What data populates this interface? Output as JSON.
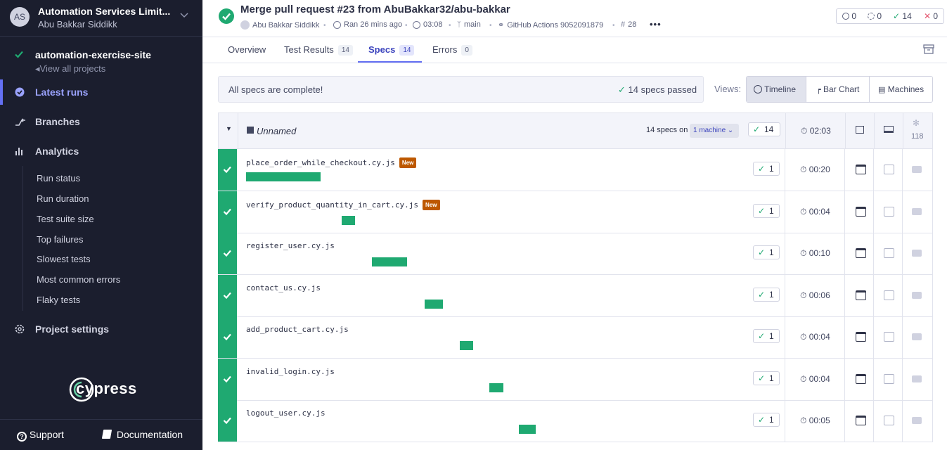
{
  "sidebar": {
    "org_avatar": "AS",
    "org_name": "Automation Services Limit...",
    "org_user": "Abu Bakkar Siddikk",
    "project_name": "automation-exercise-site",
    "view_all": "View all projects",
    "nav": {
      "latest_runs": "Latest runs",
      "branches": "Branches",
      "analytics": "Analytics",
      "project_settings": "Project settings"
    },
    "analytics_items": [
      "Run status",
      "Run duration",
      "Test suite size",
      "Top failures",
      "Slowest tests",
      "Most common errors",
      "Flaky tests"
    ],
    "logo_text": "cypress",
    "support": "Support",
    "documentation": "Documentation"
  },
  "header": {
    "title": "Merge pull request #23 from AbuBakkar32/abu-bakkar",
    "author": "Abu Bakkar Siddikk",
    "ran": "Ran 26 mins ago",
    "duration": "03:08",
    "branch": "main",
    "ci": "GitHub Actions 9052091879",
    "run_number": "28",
    "more": "•••",
    "counts": {
      "skipped": "0",
      "pending": "0",
      "passed": "14",
      "failed": "0"
    }
  },
  "tabs": [
    {
      "label": "Overview",
      "count": ""
    },
    {
      "label": "Test Results",
      "count": "14"
    },
    {
      "label": "Specs",
      "count": "14"
    },
    {
      "label": "Errors",
      "count": "0"
    }
  ],
  "status": {
    "message": "All specs are complete!",
    "passed": "14 specs passed"
  },
  "views": {
    "label": "Views:",
    "timeline": "Timeline",
    "bar_chart": "Bar Chart",
    "machines": "Machines"
  },
  "group": {
    "name": "Unnamed",
    "specs_on": "14 specs on",
    "machine": "1 machine",
    "passed": "14",
    "duration": "02:03",
    "tests": "118"
  },
  "specs": [
    {
      "name": "place_order_while_checkout.cy.js",
      "new": "New",
      "passed": "1",
      "duration": "00:20",
      "start": 0,
      "length": 20
    },
    {
      "name": "verify_product_quantity_in_cart.cy.js",
      "new": "New",
      "passed": "1",
      "duration": "00:04",
      "start": 25.7,
      "length": 3.6
    },
    {
      "name": "register_user.cy.js",
      "new": "",
      "passed": "1",
      "duration": "00:10",
      "start": 33.7,
      "length": 9.6
    },
    {
      "name": "contact_us.cy.js",
      "new": "",
      "passed": "1",
      "duration": "00:06",
      "start": 47.9,
      "length": 4.9
    },
    {
      "name": "add_product_cart.cy.js",
      "new": "",
      "passed": "1",
      "duration": "00:04",
      "start": 57.3,
      "length": 3.6
    },
    {
      "name": "invalid_login.cy.js",
      "new": "",
      "passed": "1",
      "duration": "00:04",
      "start": 65.2,
      "length": 3.8
    },
    {
      "name": "logout_user.cy.js",
      "new": "",
      "passed": "1",
      "duration": "00:05",
      "start": 73.2,
      "length": 4.5
    }
  ],
  "colors": {
    "pass": "#1fa971",
    "accent": "#6470f3",
    "sidebar": "#1b1e2e",
    "new_badge": "#bd5800"
  }
}
